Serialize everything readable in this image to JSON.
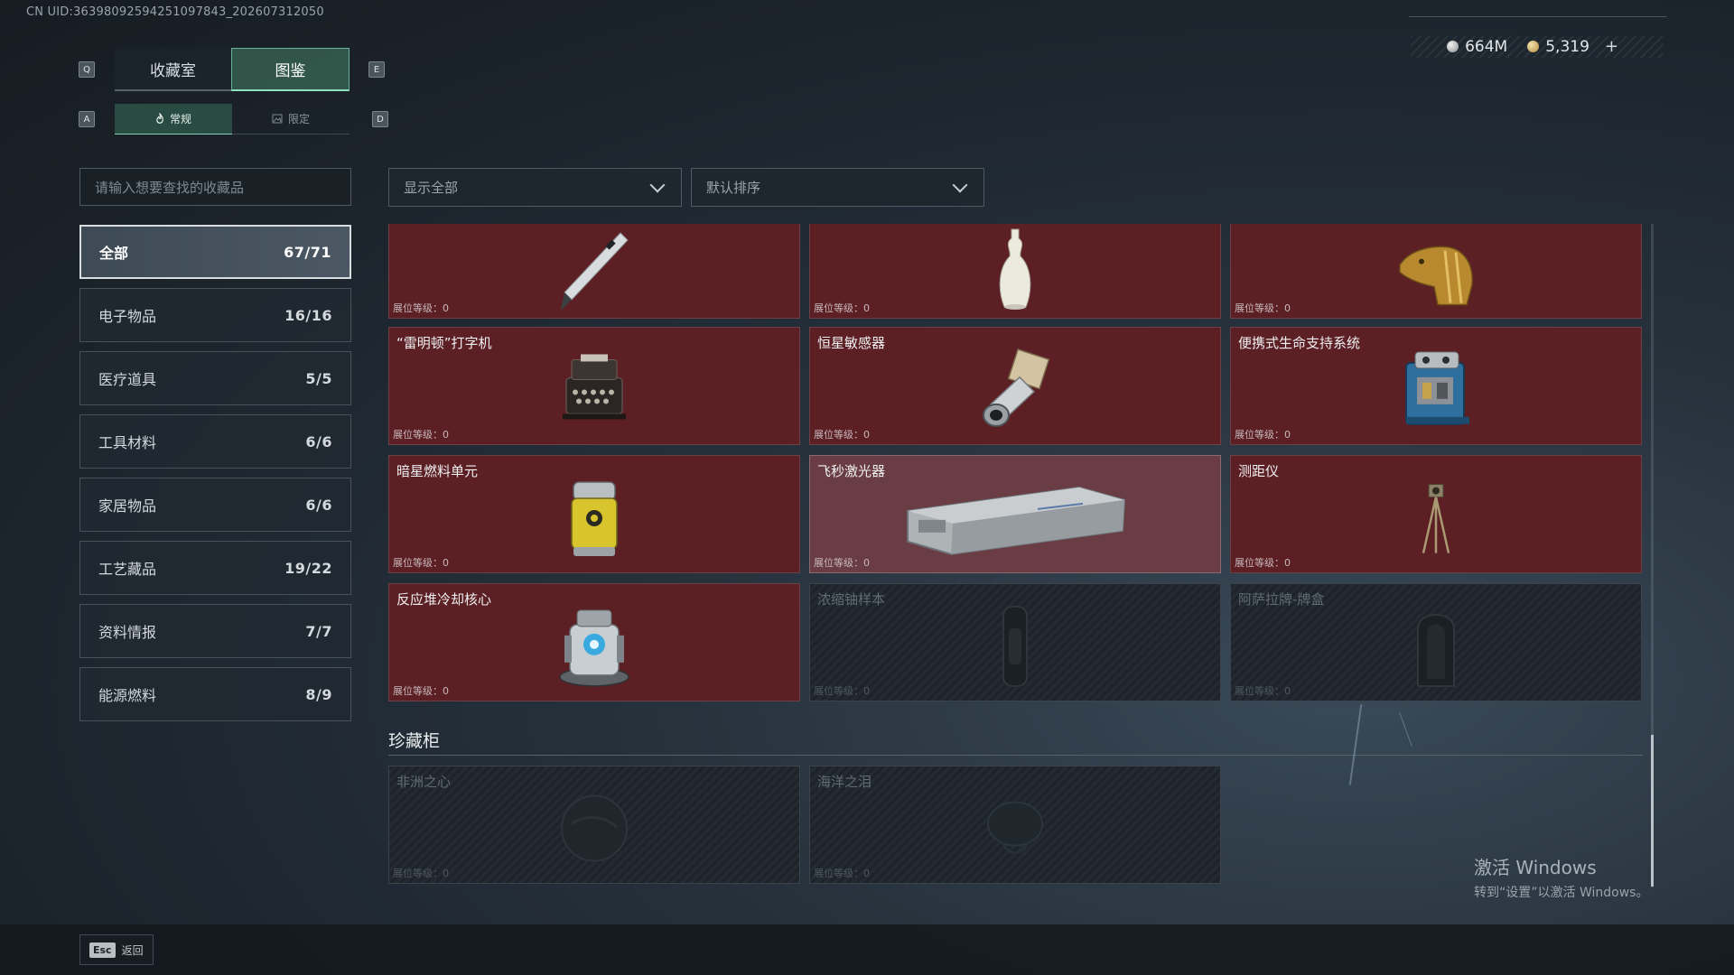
{
  "uid": "CN UID:36398092594251097843_202607312050",
  "currency": [
    {
      "icon": "silver-coin-icon",
      "value": "664M"
    },
    {
      "icon": "gold-coin-icon",
      "value": "5,319"
    }
  ],
  "currency_add": "+",
  "keys": {
    "tab_prev": "Q",
    "tab_next": "E",
    "sub_prev": "A",
    "sub_next": "D"
  },
  "main_tabs": [
    {
      "label": "收藏室",
      "active": false
    },
    {
      "label": "图鉴",
      "active": true
    }
  ],
  "sub_tabs": [
    {
      "label": "常规",
      "icon": "flame-icon",
      "active": true
    },
    {
      "label": "限定",
      "icon": "image-icon",
      "active": false
    }
  ],
  "search": {
    "placeholder": "请输入想要查找的收藏品"
  },
  "categories": [
    {
      "label": "全部",
      "count": "67/71",
      "active": true
    },
    {
      "label": "电子物品",
      "count": "16/16"
    },
    {
      "label": "医疗道具",
      "count": "5/5"
    },
    {
      "label": "工具材料",
      "count": "6/6"
    },
    {
      "label": "家居物品",
      "count": "6/6"
    },
    {
      "label": "工艺藏品",
      "count": "19/22"
    },
    {
      "label": "资料情报",
      "count": "7/7"
    },
    {
      "label": "能源燃料",
      "count": "8/9"
    }
  ],
  "filter_dropdown": {
    "value": "显示全部"
  },
  "sort_dropdown": {
    "value": "默认排序"
  },
  "level_label": "展位等级：0",
  "items": [
    {
      "name": "",
      "art": "pen"
    },
    {
      "name": "",
      "art": "vase"
    },
    {
      "name": "",
      "art": "golden-head"
    },
    {
      "name": "“雷明顿”打字机",
      "art": "typewriter"
    },
    {
      "name": "恒星敏感器",
      "art": "sensor"
    },
    {
      "name": "便携式生命支持系统",
      "art": "life-support"
    },
    {
      "name": "暗星燃料单元",
      "art": "fuel-cell"
    },
    {
      "name": "飞秒激光器",
      "art": "laser-box",
      "highlight": true
    },
    {
      "name": "测距仪",
      "art": "tripod"
    },
    {
      "name": "反应堆冷却核心",
      "art": "reactor-core"
    },
    {
      "name": "浓缩铀样本",
      "art": "capsule",
      "locked": true
    },
    {
      "name": "阿萨拉牌-牌盒",
      "art": "card-box",
      "locked": true
    }
  ],
  "showcase": {
    "title": "珍藏柜",
    "items": [
      {
        "name": "非洲之心",
        "art": "sphere",
        "locked": true
      },
      {
        "name": "海洋之泪",
        "art": "jewel",
        "locked": true
      }
    ]
  },
  "watermark": {
    "line1": "激活 Windows",
    "line2": "转到“设置”以激活 Windows。"
  },
  "footer": {
    "esc_key": "Esc",
    "back_label": "返回"
  }
}
